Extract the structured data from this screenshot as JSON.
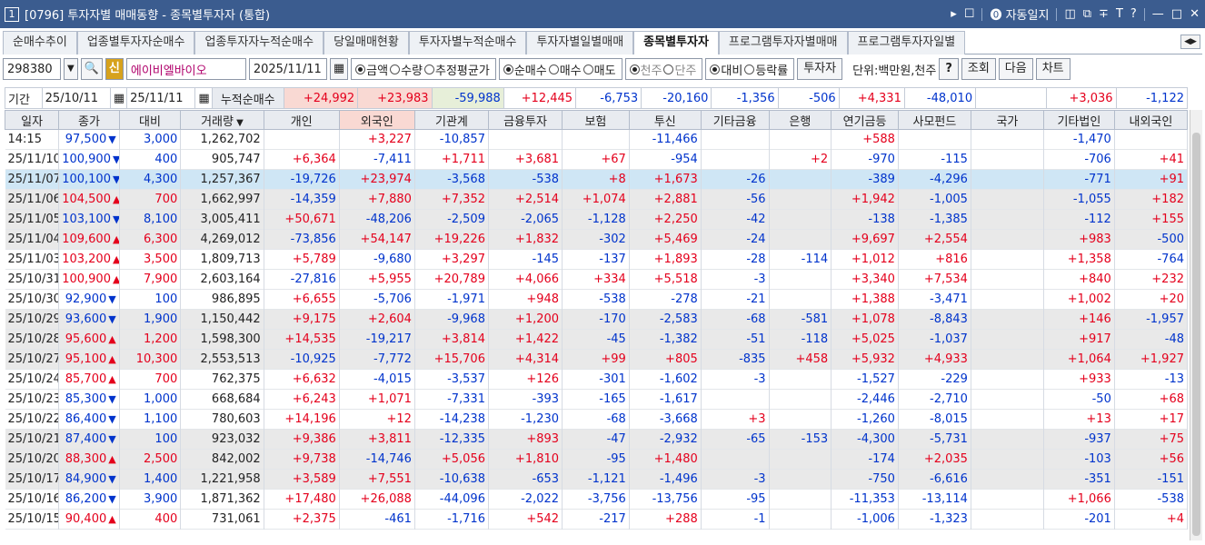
{
  "window": {
    "badge": "1",
    "title": "[0796] 투자자별 매매동향 - 종목별투자자 (통합)",
    "right_items": [
      "▸",
      "☐",
      "자동일지",
      "◫",
      "⧉",
      "∓",
      "T",
      "?",
      "—",
      "□",
      "✕"
    ]
  },
  "tabs": [
    "순매수추이",
    "업종별투자자순매수",
    "업종투자자누적순매수",
    "당일매매현황",
    "투자자별누적순매수",
    "투자자별일별매매",
    "종목별투자자",
    "프로그램투자자별매매",
    "프로그램투자자일별"
  ],
  "active_tab": 6,
  "toolbar": {
    "code": "298380",
    "sin": "신",
    "stock_name": "에이비엘바이오",
    "date": "2025/11/11",
    "radio1": [
      {
        "label": "금액",
        "on": true
      },
      {
        "label": "수량",
        "on": false
      },
      {
        "label": "추정평균가",
        "on": false
      }
    ],
    "radio2": [
      {
        "label": "순매수",
        "on": true
      },
      {
        "label": "매수",
        "on": false
      },
      {
        "label": "매도",
        "on": false
      }
    ],
    "radio3": [
      {
        "label": "천주",
        "on": true
      },
      {
        "label": "단주",
        "on": false
      }
    ],
    "radio4": [
      {
        "label": "대비",
        "on": true
      },
      {
        "label": "등락률",
        "on": false
      }
    ],
    "investor_btn": "투자자",
    "unit": "단위:백만원,천주",
    "help": "?",
    "query": "조회",
    "next": "다음",
    "chart": "차트"
  },
  "summary": {
    "label": "기간",
    "from": "25/10/11",
    "to": "25/11/11",
    "cumulative": "누적순매수",
    "values": [
      "+24,992",
      "+23,983",
      "-59,988",
      "+12,445",
      "-6,753",
      "-20,160",
      "-1,356",
      "-506",
      "+4,331",
      "-48,010",
      "",
      "+3,036",
      "-1,122"
    ]
  },
  "columns": [
    "일자",
    "종가",
    "대비",
    "거래량",
    "개인",
    "외국인",
    "기관계",
    "금융투자",
    "보험",
    "투신",
    "기타금융",
    "은행",
    "연기금등",
    "사모펀드",
    "국가",
    "기타법인",
    "내외국인"
  ],
  "rows": [
    [
      "14:15",
      "97,500",
      "down",
      "3,000",
      "1,262,702",
      "",
      "+3,227",
      "-10,857",
      "",
      "",
      "-11,466",
      "",
      "",
      "+588",
      "",
      "",
      "-1,470",
      ""
    ],
    [
      "25/11/10",
      "100,900",
      "down",
      "400",
      "905,747",
      "+6,364",
      "-7,411",
      "+1,711",
      "+3,681",
      "+67",
      "-954",
      "",
      "+2",
      "-970",
      "-115",
      "",
      "-706",
      "+41"
    ],
    [
      "25/11/07",
      "100,100",
      "down",
      "4,300",
      "1,257,367",
      "-19,726",
      "+23,974",
      "-3,568",
      "-538",
      "+8",
      "+1,673",
      "-26",
      "",
      "-389",
      "-4,296",
      "",
      "-771",
      "+91"
    ],
    [
      "25/11/06",
      "104,500",
      "up",
      "700",
      "1,662,997",
      "-14,359",
      "+7,880",
      "+7,352",
      "+2,514",
      "+1,074",
      "+2,881",
      "-56",
      "",
      "+1,942",
      "-1,005",
      "",
      "-1,055",
      "+182"
    ],
    [
      "25/11/05",
      "103,100",
      "down",
      "8,100",
      "3,005,411",
      "+50,671",
      "-48,206",
      "-2,509",
      "-2,065",
      "-1,128",
      "+2,250",
      "-42",
      "",
      "-138",
      "-1,385",
      "",
      "-112",
      "+155"
    ],
    [
      "25/11/04",
      "109,600",
      "up",
      "6,300",
      "4,269,012",
      "-73,856",
      "+54,147",
      "+19,226",
      "+1,832",
      "-302",
      "+5,469",
      "-24",
      "",
      "+9,697",
      "+2,554",
      "",
      "+983",
      "-500"
    ],
    [
      "25/11/03",
      "103,200",
      "up",
      "3,500",
      "1,809,713",
      "+5,789",
      "-9,680",
      "+3,297",
      "-145",
      "-137",
      "+1,893",
      "-28",
      "-114",
      "+1,012",
      "+816",
      "",
      "+1,358",
      "-764"
    ],
    [
      "25/10/31",
      "100,900",
      "up",
      "7,900",
      "2,603,164",
      "-27,816",
      "+5,955",
      "+20,789",
      "+4,066",
      "+334",
      "+5,518",
      "-3",
      "",
      "+3,340",
      "+7,534",
      "",
      "+840",
      "+232"
    ],
    [
      "25/10/30",
      "92,900",
      "down",
      "100",
      "986,895",
      "+6,655",
      "-5,706",
      "-1,971",
      "+948",
      "-538",
      "-278",
      "-21",
      "",
      "+1,388",
      "-3,471",
      "",
      "+1,002",
      "+20"
    ],
    [
      "25/10/29",
      "93,600",
      "down",
      "1,900",
      "1,150,442",
      "+9,175",
      "+2,604",
      "-9,968",
      "+1,200",
      "-170",
      "-2,583",
      "-68",
      "-581",
      "+1,078",
      "-8,843",
      "",
      "+146",
      "-1,957"
    ],
    [
      "25/10/28",
      "95,600",
      "up",
      "1,200",
      "1,598,300",
      "+14,535",
      "-19,217",
      "+3,814",
      "+1,422",
      "-45",
      "-1,382",
      "-51",
      "-118",
      "+5,025",
      "-1,037",
      "",
      "+917",
      "-48"
    ],
    [
      "25/10/27",
      "95,100",
      "up",
      "10,300",
      "2,553,513",
      "-10,925",
      "-7,772",
      "+15,706",
      "+4,314",
      "+99",
      "+805",
      "-835",
      "+458",
      "+5,932",
      "+4,933",
      "",
      "+1,064",
      "+1,927"
    ],
    [
      "25/10/24",
      "85,700",
      "up",
      "700",
      "762,375",
      "+6,632",
      "-4,015",
      "-3,537",
      "+126",
      "-301",
      "-1,602",
      "-3",
      "",
      "-1,527",
      "-229",
      "",
      "+933",
      "-13"
    ],
    [
      "25/10/23",
      "85,300",
      "down",
      "1,000",
      "668,684",
      "+6,243",
      "+1,071",
      "-7,331",
      "-393",
      "-165",
      "-1,617",
      "",
      "",
      "-2,446",
      "-2,710",
      "",
      "-50",
      "+68"
    ],
    [
      "25/10/22",
      "86,400",
      "down",
      "1,100",
      "780,603",
      "+14,196",
      "+12",
      "-14,238",
      "-1,230",
      "-68",
      "-3,668",
      "+3",
      "",
      "-1,260",
      "-8,015",
      "",
      "+13",
      "+17"
    ],
    [
      "25/10/21",
      "87,400",
      "down",
      "100",
      "923,032",
      "+9,386",
      "+3,811",
      "-12,335",
      "+893",
      "-47",
      "-2,932",
      "-65",
      "-153",
      "-4,300",
      "-5,731",
      "",
      "-937",
      "+75"
    ],
    [
      "25/10/20",
      "88,300",
      "up",
      "2,500",
      "842,002",
      "+9,738",
      "-14,746",
      "+5,056",
      "+1,810",
      "-95",
      "+1,480",
      "",
      "",
      "-174",
      "+2,035",
      "",
      "-103",
      "+56"
    ],
    [
      "25/10/17",
      "84,900",
      "down",
      "1,400",
      "1,221,958",
      "+3,589",
      "+7,551",
      "-10,638",
      "-653",
      "-1,121",
      "-1,496",
      "-3",
      "",
      "-750",
      "-6,616",
      "",
      "-351",
      "-151"
    ],
    [
      "25/10/16",
      "86,200",
      "down",
      "3,900",
      "1,871,362",
      "+17,480",
      "+26,088",
      "-44,096",
      "-2,022",
      "-3,756",
      "-13,756",
      "-95",
      "",
      "-11,353",
      "-13,114",
      "",
      "+1,066",
      "-538"
    ],
    [
      "25/10/15",
      "90,400",
      "up",
      "400",
      "731,061",
      "+2,375",
      "-461",
      "-1,716",
      "+542",
      "-217",
      "+288",
      "-1",
      "",
      "-1,006",
      "-1,323",
      "",
      "-201",
      "+4"
    ]
  ],
  "colors": {
    "title_bar": "#3b5c8f",
    "up": "#e4001c",
    "down": "#0033cc",
    "selected_row": "#cfe6f5",
    "alt_row": "#e9e9e9"
  }
}
